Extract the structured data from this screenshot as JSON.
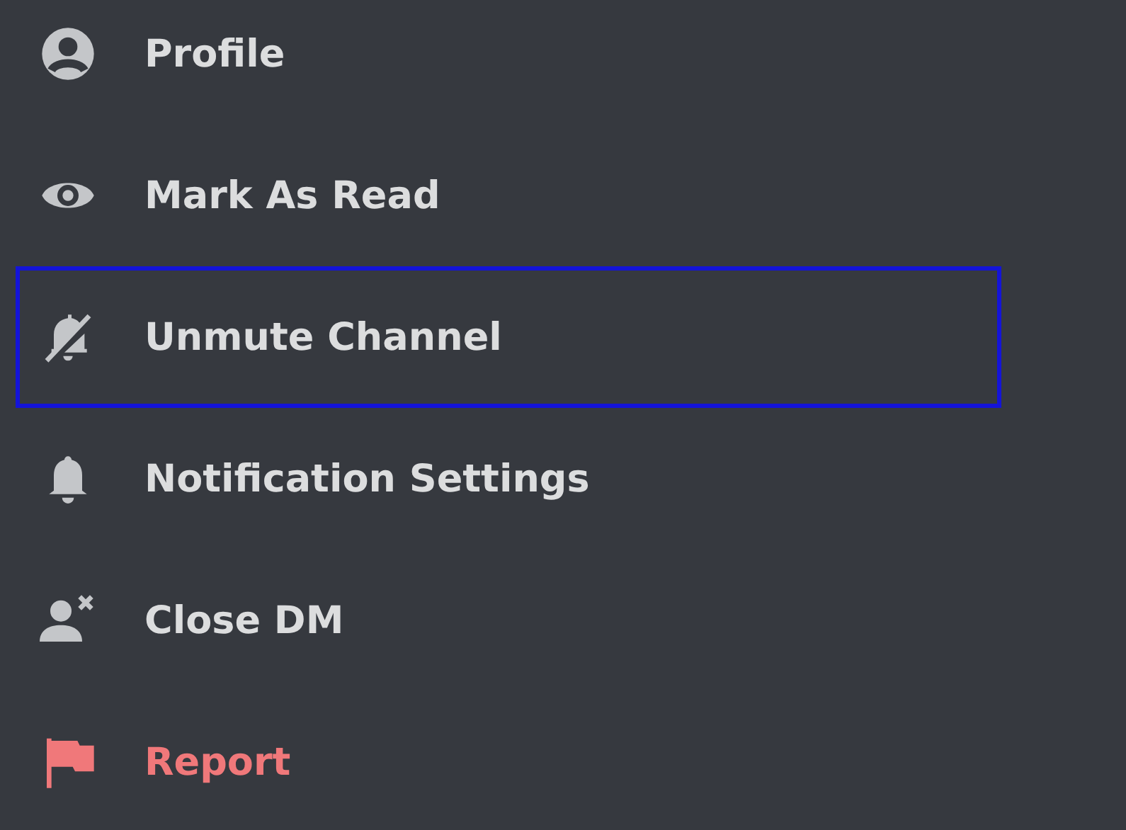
{
  "menu": {
    "items": [
      {
        "label": "Profile",
        "kind": "profile",
        "danger": false,
        "highlighted": false
      },
      {
        "label": "Mark As Read",
        "kind": "read",
        "danger": false,
        "highlighted": false
      },
      {
        "label": "Unmute Channel",
        "kind": "unmute",
        "danger": false,
        "highlighted": true
      },
      {
        "label": "Notification Settings",
        "kind": "notifications",
        "danger": false,
        "highlighted": false
      },
      {
        "label": "Close DM",
        "kind": "close-dm",
        "danger": false,
        "highlighted": false
      },
      {
        "label": "Report",
        "kind": "report",
        "danger": true,
        "highlighted": false
      }
    ]
  }
}
